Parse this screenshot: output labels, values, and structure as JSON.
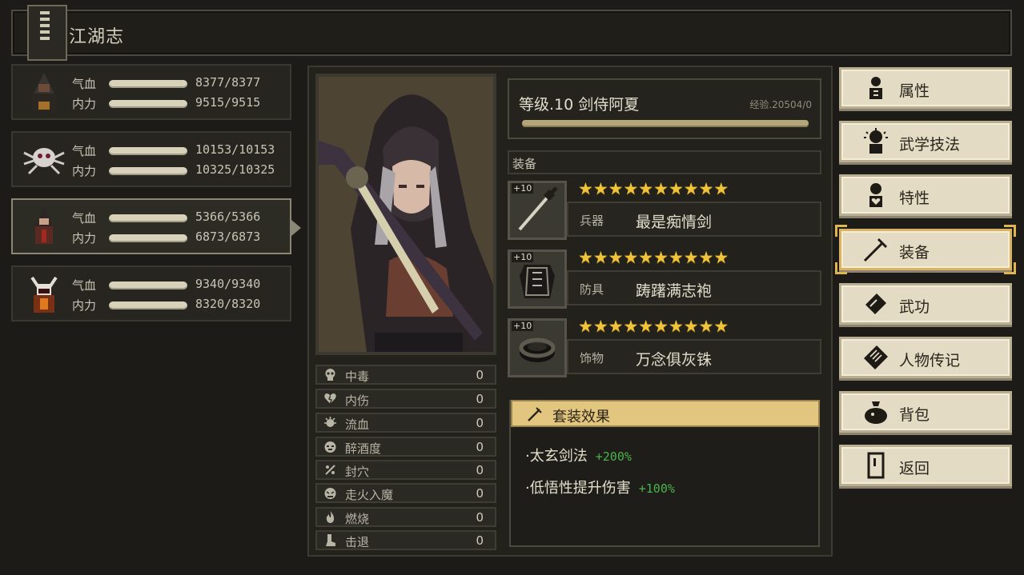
{
  "header": {
    "title": "江湖志"
  },
  "party": [
    {
      "hp_label": "气血",
      "hp": "8377/8377",
      "mp_label": "内力",
      "mp": "9515/9515",
      "selected": false
    },
    {
      "hp_label": "气血",
      "hp": "10153/10153",
      "mp_label": "内力",
      "mp": "10325/10325",
      "selected": false
    },
    {
      "hp_label": "气血",
      "hp": "5366/5366",
      "mp_label": "内力",
      "mp": "6873/6873",
      "selected": true
    },
    {
      "hp_label": "气血",
      "hp": "9340/9340",
      "mp_label": "内力",
      "mp": "8320/8320",
      "selected": false
    }
  ],
  "character": {
    "level_name": "等级.10 剑侍阿夏",
    "exp": "经验.20504/0"
  },
  "status": [
    {
      "name": "中毒",
      "value": "0",
      "icon": "skull-icon"
    },
    {
      "name": "内伤",
      "value": "0",
      "icon": "broken-heart-icon"
    },
    {
      "name": "流血",
      "value": "0",
      "icon": "blood-icon"
    },
    {
      "name": "醉酒度",
      "value": "0",
      "icon": "drunk-face-icon"
    },
    {
      "name": "封穴",
      "value": "0",
      "icon": "acupoint-icon"
    },
    {
      "name": "走火入魔",
      "value": "0",
      "icon": "demon-face-icon"
    },
    {
      "name": "燃烧",
      "value": "0",
      "icon": "fire-icon"
    },
    {
      "name": "击退",
      "value": "0",
      "icon": "boot-icon"
    }
  ],
  "equipment": {
    "header": "装备",
    "items": [
      {
        "slot": "兵器",
        "name": "最是痴情剑",
        "plus": "+10",
        "stars": "★★★★★★★★★★",
        "icon": "sword-icon"
      },
      {
        "slot": "防具",
        "name": "踌躇满志袍",
        "plus": "+10",
        "stars": "★★★★★★★★★★",
        "icon": "armor-icon"
      },
      {
        "slot": "饰物",
        "name": "万念俱灰铢",
        "plus": "+10",
        "stars": "★★★★★★★★★★",
        "icon": "ring-icon"
      }
    ]
  },
  "set_effect": {
    "title": "套装效果",
    "lines": [
      {
        "text": "·太玄剑法",
        "bonus": "+200%"
      },
      {
        "text": "·低悟性提升伤害",
        "bonus": "+100%"
      }
    ]
  },
  "menu": [
    {
      "label": "属性",
      "icon": "person-stats-icon",
      "active": false
    },
    {
      "label": "武学技法",
      "icon": "martial-skill-icon",
      "active": false
    },
    {
      "label": "特性",
      "icon": "trait-icon",
      "active": false
    },
    {
      "label": "装备",
      "icon": "sword-icon",
      "active": true
    },
    {
      "label": "武功",
      "icon": "manual-book-icon",
      "active": false
    },
    {
      "label": "人物传记",
      "icon": "biography-icon",
      "active": false
    },
    {
      "label": "背包",
      "icon": "bag-icon",
      "active": false
    },
    {
      "label": "返回",
      "icon": "door-icon",
      "active": false
    }
  ],
  "colors": {
    "accent": "#e2c67f",
    "star": "#f0c43a",
    "bonus": "#4ab34a",
    "menu_bg": "#e3dbc3"
  }
}
